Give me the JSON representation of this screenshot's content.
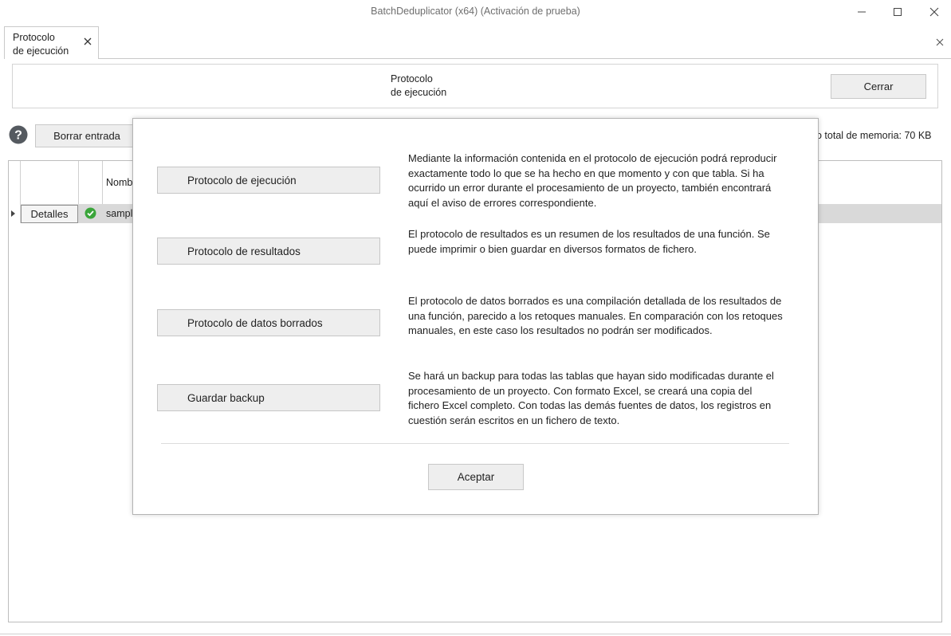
{
  "window": {
    "title": "BatchDeduplicator  (x64) (Activación de prueba)"
  },
  "tab": {
    "label": "Protocolo\nde ejecución"
  },
  "header": {
    "title": "Protocolo\nde ejecución",
    "close_label": "Cerrar"
  },
  "toolbar": {
    "delete_entry_label": "Borrar entrada",
    "memory_text": "o total de memoria: 70 KB"
  },
  "grid": {
    "column_name_header": "Nomb",
    "row": {
      "details_label": "Detalles",
      "name_cell": "sampl"
    }
  },
  "modal": {
    "items": [
      {
        "button_label": "Protocolo de ejecución",
        "description": "Mediante la información contenida en el protocolo de ejecución podrá reproducir exactamente todo lo que se ha hecho en que momento y con que tabla. Si ha ocurrido un error durante el procesamiento de un proyecto, también encontrará aquí el aviso de errores correspondiente."
      },
      {
        "button_label": "Protocolo de resultados",
        "description": "El protocolo de resultados es un resumen de los resultados de una función. Se puede imprimir o bien guardar en diversos formatos de fichero."
      },
      {
        "button_label": "Protocolo de datos borrados",
        "description": "El protocolo de datos borrados es una compilación detallada de los resultados de una función, parecido a los retoques manuales. En comparación con los retoques manuales, en este caso los resultados no podrán ser modificados."
      },
      {
        "button_label": "Guardar backup",
        "description": "Se hará un backup para todas las tablas que hayan sido modificadas durante el procesamiento de un proyecto. Con formato Excel, se creará una copia del fichero Excel completo. Con todas las demás fuentes de datos, los registros en cuestión serán escritos en un fichero de texto."
      }
    ],
    "accept_label": "Aceptar"
  },
  "icons": {
    "minimize": "minimize-icon",
    "maximize": "maximize-icon",
    "close": "close-icon",
    "help": "help-icon",
    "status": "check-circle-icon"
  },
  "colors": {
    "status_ok": "#3aa53a",
    "help_icon": "#555a60",
    "selected_row": "#d9d9d9"
  }
}
